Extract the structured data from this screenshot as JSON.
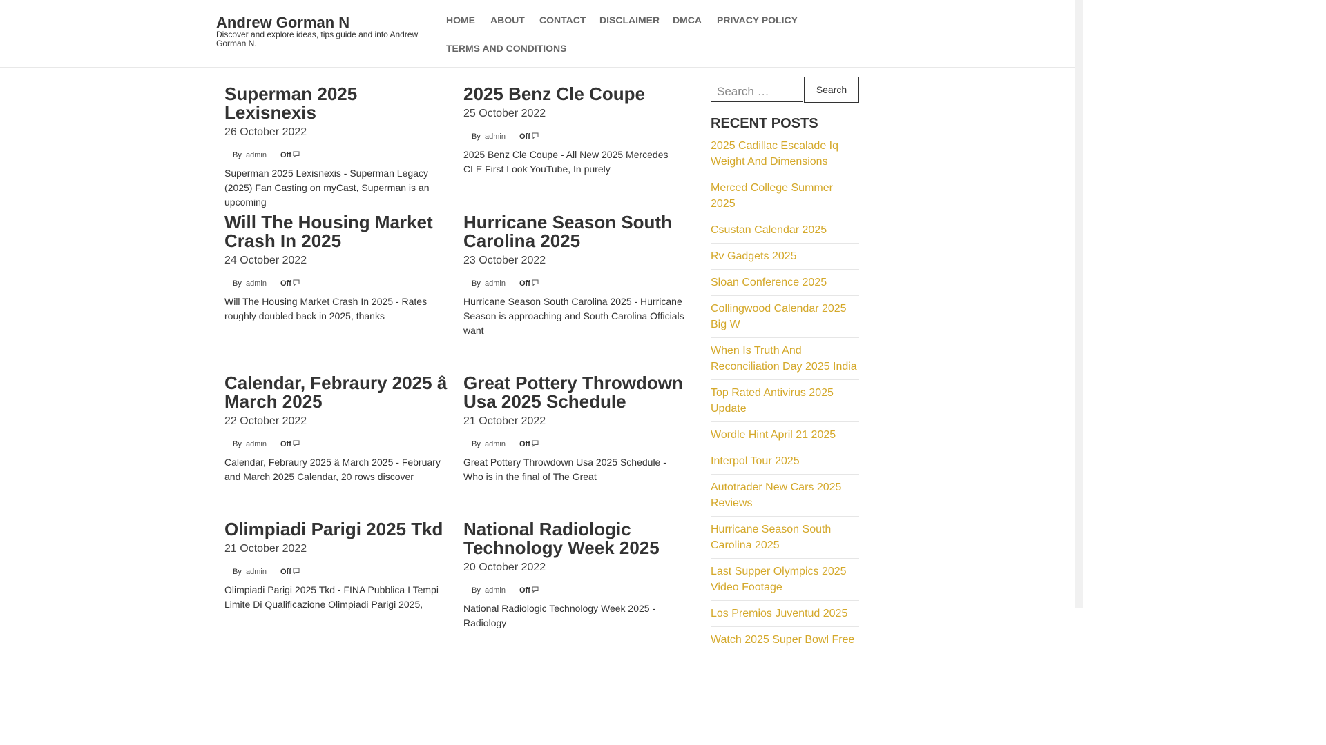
{
  "site": {
    "title": "Andrew Gorman N",
    "description": "Discover and explore ideas, tips guide and info Andrew Gorman N."
  },
  "nav": {
    "items": [
      {
        "label": "HOME"
      },
      {
        "label": "ABOUT"
      },
      {
        "label": "CONTACT"
      },
      {
        "label": "DISCLAIMER"
      },
      {
        "label": "DMCA"
      },
      {
        "label": "PRIVACY POLICY"
      },
      {
        "label": "TERMS AND CONDITIONS"
      }
    ]
  },
  "posts": [
    {
      "title": "Superman 2025 Lexisnexis",
      "date": "26 October 2022",
      "by": "By",
      "author": "admin",
      "comments": "Off",
      "excerpt": "Superman 2025 Lexisnexis - Superman Legacy (2025) Fan Casting on myCast, Superman is an upcoming"
    },
    {
      "title": "2025 Benz Cle Coupe",
      "date": "25 October 2022",
      "by": "By",
      "author": "admin",
      "comments": "Off",
      "excerpt": "2025 Benz Cle Coupe - All New 2025 Mercedes CLE First Look YouTube, In purely"
    },
    {
      "title": "Will The Housing Market Crash In 2025",
      "date": "24 October 2022",
      "by": "By",
      "author": "admin",
      "comments": "Off",
      "excerpt": "Will The Housing Market Crash In 2025 - Rates roughly doubled back in 2025, thanks"
    },
    {
      "title": "Hurricane Season South Carolina 2025",
      "date": "23 October 2022",
      "by": "By",
      "author": "admin",
      "comments": "Off",
      "excerpt": "Hurricane Season South Carolina 2025 - Hurricane Season is approaching and South Carolina Officials want"
    },
    {
      "title": "Calendar, Febraury 2025 â March 2025",
      "date": "22 October 2022",
      "by": "By",
      "author": "admin",
      "comments": "Off",
      "excerpt": "Calendar, Febraury 2025 â March 2025 - February and March 2025 Calendar, 20 rows discover"
    },
    {
      "title": "Great Pottery Throwdown Usa 2025 Schedule",
      "date": "21 October 2022",
      "by": "By",
      "author": "admin",
      "comments": "Off",
      "excerpt": "Great Pottery Throwdown Usa 2025 Schedule - Who is in the final of The Great"
    },
    {
      "title": "Olimpiadi Parigi 2025 Tkd",
      "date": "21 October 2022",
      "by": "By",
      "author": "admin",
      "comments": "Off",
      "excerpt": "Olimpiadi Parigi 2025 Tkd - FINA Pubblica I Tempi Limite Di Qualificazione Olimpiadi Parigi 2025,"
    },
    {
      "title": "National Radiologic Technology Week 2025",
      "date": "20 October 2022",
      "by": "By",
      "author": "admin",
      "comments": "Off",
      "excerpt": "National Radiologic Technology Week 2025 - Radiology"
    }
  ],
  "sidebar": {
    "search_placeholder": "Search …",
    "search_button": "Search",
    "recent_title": "RECENT POSTS",
    "recent": [
      "2025 Cadillac Escalade Iq Weight And Dimensions",
      "Merced College Summer 2025",
      "Csustan Calendar 2025",
      "Rv Gadgets 2025",
      "Sloan Conference 2025",
      "Collingwood Calendar 2025 Big W",
      "When Is Truth And Reconciliation Day 2025 India",
      "Top Rated Antivirus 2025 Update",
      "Wordle Hint April 21 2025",
      "Interpol Tour 2025",
      "Autotrader New Cars 2025 Reviews",
      "Hurricane Season South Carolina 2025",
      "Last Supper Olympics 2025 Video Footage",
      "Los Premios Juventud 2025",
      "Watch 2025 Super Bowl Free"
    ]
  },
  "colors": {
    "link": "#d4a82a",
    "nav": "#666666",
    "text": "#333333"
  }
}
